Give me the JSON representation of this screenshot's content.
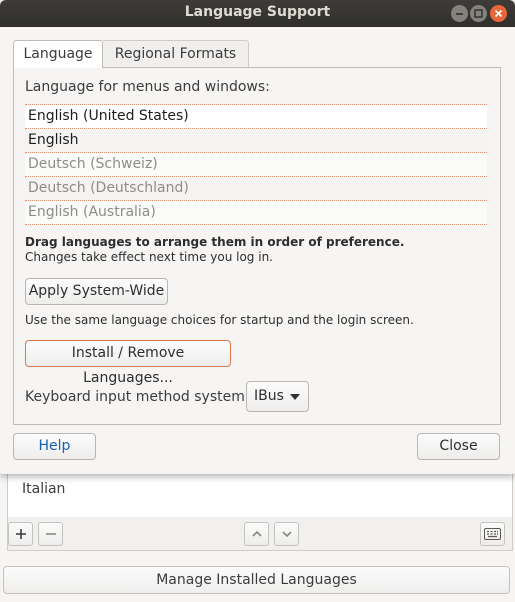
{
  "background_window": {
    "list_items": [
      "Italian"
    ],
    "toolbar": {
      "add": "add-icon",
      "remove": "remove-icon",
      "up": "chevron-up-icon",
      "down": "chevron-down-icon",
      "keyboard": "keyboard-icon"
    },
    "manage_button_label": "Manage Installed Languages"
  },
  "dialog": {
    "title": "Language Support",
    "tabs": [
      {
        "label": "Language",
        "active": true
      },
      {
        "label": "Regional Formats",
        "active": false
      }
    ],
    "menus_label": "Language for menus and windows:",
    "languages": [
      {
        "name": "English (United States)",
        "dim": false
      },
      {
        "name": "English",
        "dim": false
      },
      {
        "name": "Deutsch (Schweiz)",
        "dim": true
      },
      {
        "name": "Deutsch (Deutschland)",
        "dim": true
      },
      {
        "name": "English (Australia)",
        "dim": true
      }
    ],
    "drag_hint_bold": "Drag languages to arrange them in order of preference.",
    "drag_hint": "Changes take effect next time you log in.",
    "apply_button": "Apply System-Wide",
    "apply_note": "Use the same language choices for startup and the login screen.",
    "install_button": "Install / Remove Languages...",
    "keyboard_label": "Keyboard input method system:",
    "keyboard_value": "IBus",
    "help_button": "Help",
    "close_button": "Close"
  },
  "colors": {
    "titlebar": "#3d3c38",
    "close_button": "#e7663a",
    "accent_focus": "#d9774f",
    "help_text": "#1a5fb4"
  }
}
